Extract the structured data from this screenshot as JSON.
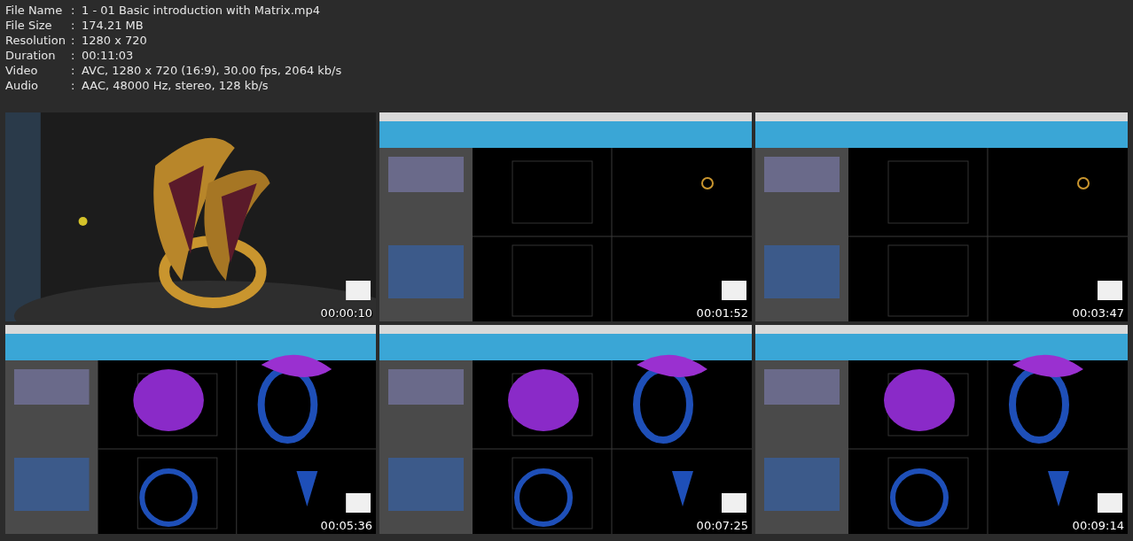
{
  "info": [
    {
      "label": "File Name",
      "separator": ":",
      "value": "1 - 01 Basic introduction with Matrix.mp4"
    },
    {
      "label": "File Size",
      "separator": ":",
      "value": "174.21 MB"
    },
    {
      "label": "Resolution",
      "separator": ":",
      "value": "1280 x 720"
    },
    {
      "label": "Duration",
      "separator": ":",
      "value": "00:11:03"
    },
    {
      "label": "Video",
      "separator": ":",
      "value": "AVC, 1280 x 720 (16:9), 30.00 fps, 2064 kb/s"
    },
    {
      "label": "Audio",
      "separator": ":",
      "value": "AAC, 48000 Hz, stereo, 128 kb/s"
    }
  ],
  "thumbnails": [
    {
      "kind": "picture",
      "time": "00:00:10"
    },
    {
      "kind": "picture",
      "time": "00:01:52"
    },
    {
      "kind": "picture",
      "time": "00:03:47"
    },
    {
      "kind": "picture",
      "time": "00:05:36"
    },
    {
      "kind": "picture",
      "time": "00:07:25"
    },
    {
      "kind": "picture",
      "time": "00:09:14"
    }
  ]
}
